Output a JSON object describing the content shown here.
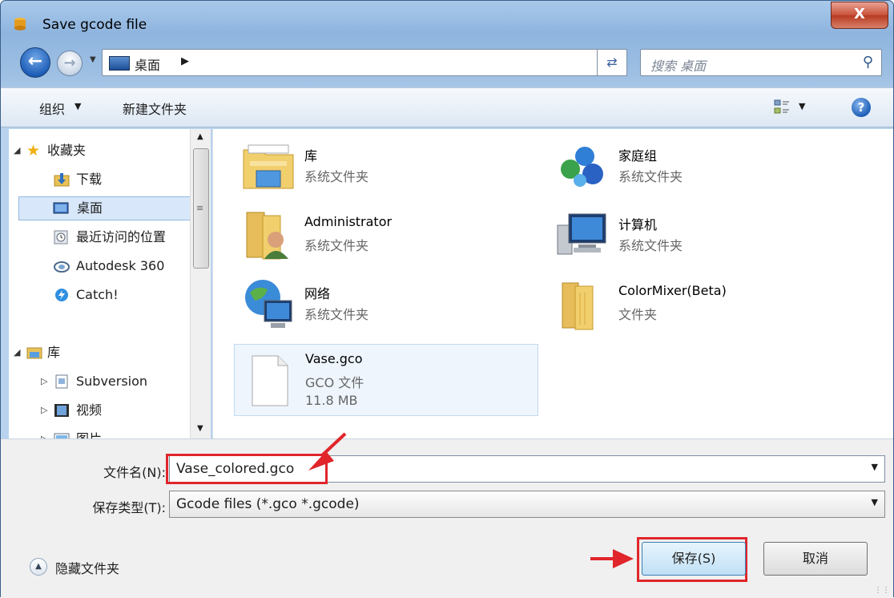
{
  "window": {
    "title": "Save gcode file",
    "close_label": "X"
  },
  "nav": {
    "location": "桌面",
    "search_placeholder": "搜索 桌面"
  },
  "toolbar": {
    "organize_label": "组织",
    "new_folder_label": "新建文件夹"
  },
  "sidebar": {
    "favorites_header": "收藏夹",
    "items": [
      {
        "label": "下载"
      },
      {
        "label": "桌面"
      },
      {
        "label": "最近访问的位置"
      },
      {
        "label": "Autodesk 360"
      },
      {
        "label": "Catch!"
      }
    ],
    "library_header": "库",
    "library_items": [
      {
        "label": "Subversion"
      },
      {
        "label": "视频"
      },
      {
        "label": "图片"
      }
    ]
  },
  "content": {
    "items": [
      {
        "name": "库",
        "type": "系统文件夹"
      },
      {
        "name": "家庭组",
        "type": "系统文件夹"
      },
      {
        "name": "Administrator",
        "type": "系统文件夹"
      },
      {
        "name": "计算机",
        "type": "系统文件夹"
      },
      {
        "name": "网络",
        "type": "系统文件夹"
      },
      {
        "name": "ColorMixer(Beta)",
        "type": "文件夹"
      },
      {
        "name": "Vase.gco",
        "type": "GCO 文件",
        "size": "11.8 MB"
      }
    ]
  },
  "form": {
    "filename_label": "文件名(N):",
    "filename_value": "Vase_colored.gco",
    "filetype_label": "保存类型(T):",
    "filetype_value": "Gcode files (*.gco *.gcode)"
  },
  "footer": {
    "hide_folders_label": "隐藏文件夹",
    "save_label": "保存(S)",
    "cancel_label": "取消"
  },
  "colors": {
    "annotation_red": "#e0262b"
  }
}
